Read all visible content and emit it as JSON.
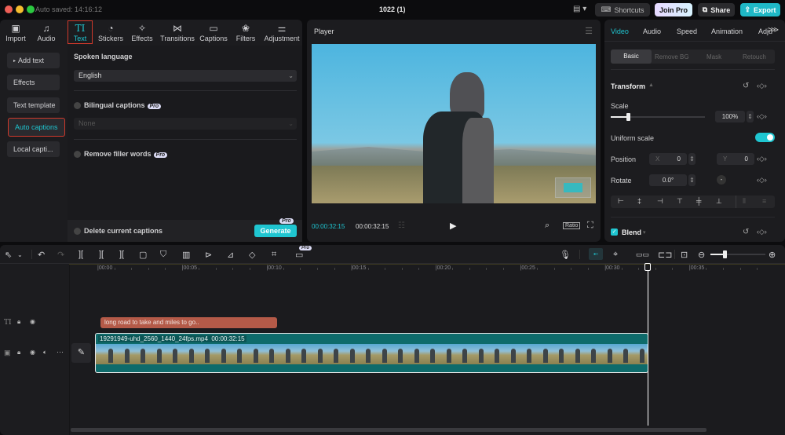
{
  "titlebar": {
    "autosave": "Auto saved: 14:16:12",
    "project_title": "1022 (1)",
    "shortcuts_label": "Shortcuts",
    "join_pro_label": "Join Pro",
    "share_label": "Share",
    "export_label": "Export"
  },
  "toolbar": {
    "items": [
      {
        "label": "Import",
        "icon": "import-icon"
      },
      {
        "label": "Audio",
        "icon": "audio-icon"
      },
      {
        "label": "Text",
        "icon": "text-icon"
      },
      {
        "label": "Stickers",
        "icon": "stickers-icon"
      },
      {
        "label": "Effects",
        "icon": "effects-icon"
      },
      {
        "label": "Transitions",
        "icon": "transitions-icon"
      },
      {
        "label": "Captions",
        "icon": "captions-icon"
      },
      {
        "label": "Filters",
        "icon": "filters-icon"
      },
      {
        "label": "Adjustment",
        "icon": "adjustment-icon"
      }
    ],
    "active": "Text"
  },
  "sidebar": {
    "items": [
      "Add text",
      "Effects",
      "Text template",
      "Auto captions",
      "Local capti..."
    ],
    "active": "Auto captions"
  },
  "captions_panel": {
    "spoken_language_label": "Spoken language",
    "spoken_language_value": "English",
    "bilingual_label": "Bilingual captions",
    "bilingual_value": "None",
    "remove_filler_label": "Remove filler words",
    "pro_badge": "Pro",
    "delete_current_label": "Delete current captions",
    "generate_label": "Generate"
  },
  "player": {
    "title": "Player",
    "current_time": "00:00:32:15",
    "total_time": "00:00:32:15",
    "ratio_label": "Ratio"
  },
  "inspector": {
    "tabs": [
      "Video",
      "Audio",
      "Speed",
      "Animation",
      "Adjust"
    ],
    "active_tab": "Video",
    "subtabs": [
      "Basic",
      "Remove BG",
      "Mask",
      "Retouch"
    ],
    "active_subtab": "Basic",
    "transform_label": "Transform",
    "scale_label": "Scale",
    "scale_value": "100%",
    "scale_slider_fraction": 0.18,
    "uniform_scale_label": "Uniform scale",
    "uniform_scale_on": true,
    "position_label": "Position",
    "x_label": "X",
    "x_value": "0",
    "y_label": "Y",
    "y_value": "0",
    "rotate_label": "Rotate",
    "rotate_value": "0.0°",
    "blend_label": "Blend"
  },
  "timeline": {
    "ruler_ticks": [
      "00:00",
      "00:05",
      "00:10",
      "00:15",
      "00:20",
      "00:25",
      "00:30",
      "00:35"
    ],
    "text_clip": "long road to take and miles to go..",
    "video_clip_name": "19291949-uhd_2560_1440_24fps.mp4",
    "video_clip_duration": "00:00:32:15",
    "zoom_fraction": 0.25
  },
  "colors": {
    "accent": "#1fc6d1",
    "text_clip": "#b45a48",
    "video_clip": "#0e6b6b",
    "highlight_box": "#d0392b"
  }
}
